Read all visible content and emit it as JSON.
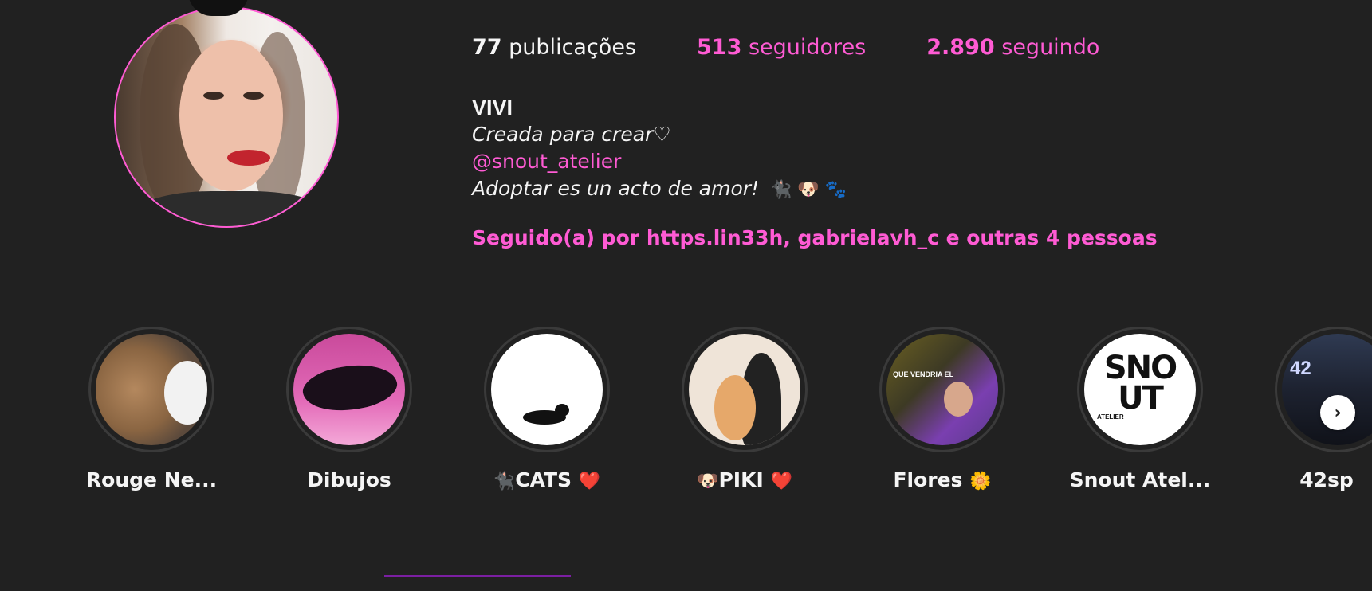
{
  "profile": {
    "stats": {
      "posts": {
        "count": "77",
        "label": "publicações"
      },
      "followers": {
        "count": "513",
        "label": "seguidores"
      },
      "following": {
        "count": "2.890",
        "label": "seguindo"
      }
    },
    "name": "VIVI",
    "bio_line1": "Creada para crear♡",
    "bio_link": "@snout_atelier",
    "bio_line3": "Adoptar es un acto de amor!",
    "bio_line3_emojis": "🐈‍⬛ 🐶 🐾",
    "followed_by": "Seguido(a) por https.lin33h, gabrielavh_c e outras 4 pessoas"
  },
  "highlights": [
    {
      "label": "Rouge Ne...",
      "emoji": "",
      "icon": "bear-and-cat-photo"
    },
    {
      "label": "Dibujos",
      "emoji": "",
      "icon": "black-cat-drawing"
    },
    {
      "label": "CATS",
      "emoji_before": "🐈‍⬛",
      "emoji": "❤️",
      "icon": "cat-silhouette"
    },
    {
      "label": "PIKI",
      "emoji_before": "🐶",
      "emoji": "❤️",
      "icon": "girl-with-dog-drawing"
    },
    {
      "label": "Flores",
      "emoji": "🌼",
      "icon": "couple-photo"
    },
    {
      "label": "Snout Atel...",
      "emoji": "",
      "icon": "snout-atelier-logo"
    },
    {
      "label": "42sp",
      "emoji": "",
      "icon": "42sp-photo"
    }
  ],
  "flores_overlay_text": "QUE VENDRIA EL",
  "snout_logo_text": "SNO UT",
  "snout_logo_sub": "ATELIER",
  "image_42_text": "42",
  "next_button_glyph": "›",
  "colors": {
    "background": "#212121",
    "accent_pink": "#ff5bd4",
    "active_tab": "#7b1fa2"
  }
}
